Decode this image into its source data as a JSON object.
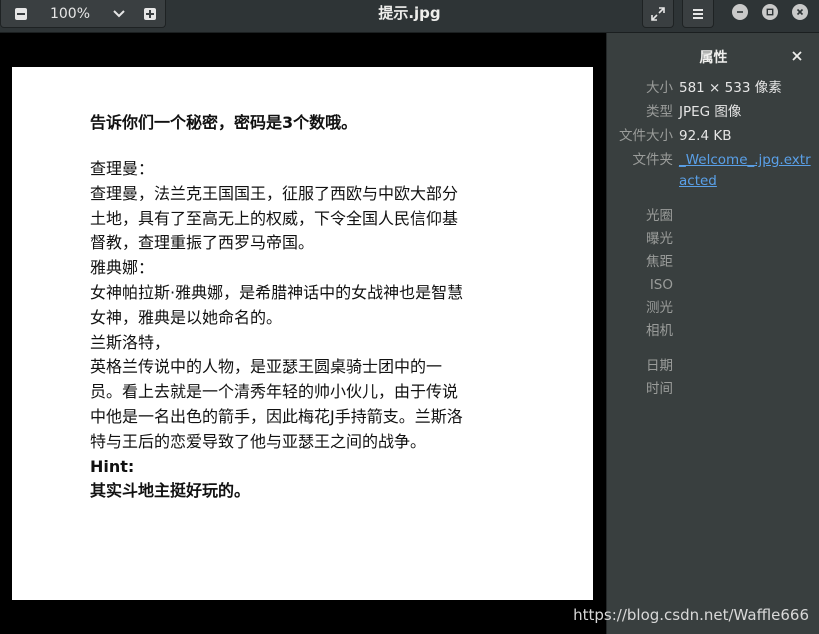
{
  "header": {
    "zoom_value": "100%",
    "title": "提示.jpg"
  },
  "image": {
    "headline": "告诉你们一个秘密，密码是3个数哦。",
    "lines": [
      "查理曼：",
      "查理曼，法兰克王国国王，征服了西欧与中欧大部分",
      "土地，具有了至高无上的权威，下令全国人民信仰基",
      "督教，查理重振了西罗马帝国。",
      "雅典娜：",
      "女神帕拉斯·雅典娜，是希腊神话中的女战神也是智慧",
      "女神，雅典是以她命名的。",
      "兰斯洛特，",
      "英格兰传说中的人物，是亚瑟王圆桌骑士团中的一",
      "员。看上去就是一个清秀年轻的帅小伙儿，由于传说",
      "中他是一名出色的箭手，因此梅花J手持箭支。兰斯洛",
      "特与王后的恋爱导致了他与亚瑟王之间的战争。"
    ],
    "hint_label": "Hint:",
    "hint_text": "其实斗地主挺好玩的。"
  },
  "sidebar": {
    "title": "属性",
    "props": [
      {
        "label": "大小",
        "value": "581 × 533 像素"
      },
      {
        "label": "类型",
        "value": "JPEG 图像"
      },
      {
        "label": "文件大小",
        "value": "92.4 KB"
      },
      {
        "label": "文件夹",
        "value_line1": "_Welcome_.jpg.extr",
        "value_line2": "acted"
      }
    ],
    "exif_labels_1": [
      "光圈",
      "曝光",
      "焦距",
      "ISO",
      "测光",
      "相机"
    ],
    "exif_labels_2": [
      "日期",
      "时间"
    ]
  },
  "watermark": "https://blog.csdn.net/Waffle666",
  "colors": {
    "headerbar": "#2e3436",
    "sidebar": "#393f3f",
    "link": "#5aa0e8"
  }
}
